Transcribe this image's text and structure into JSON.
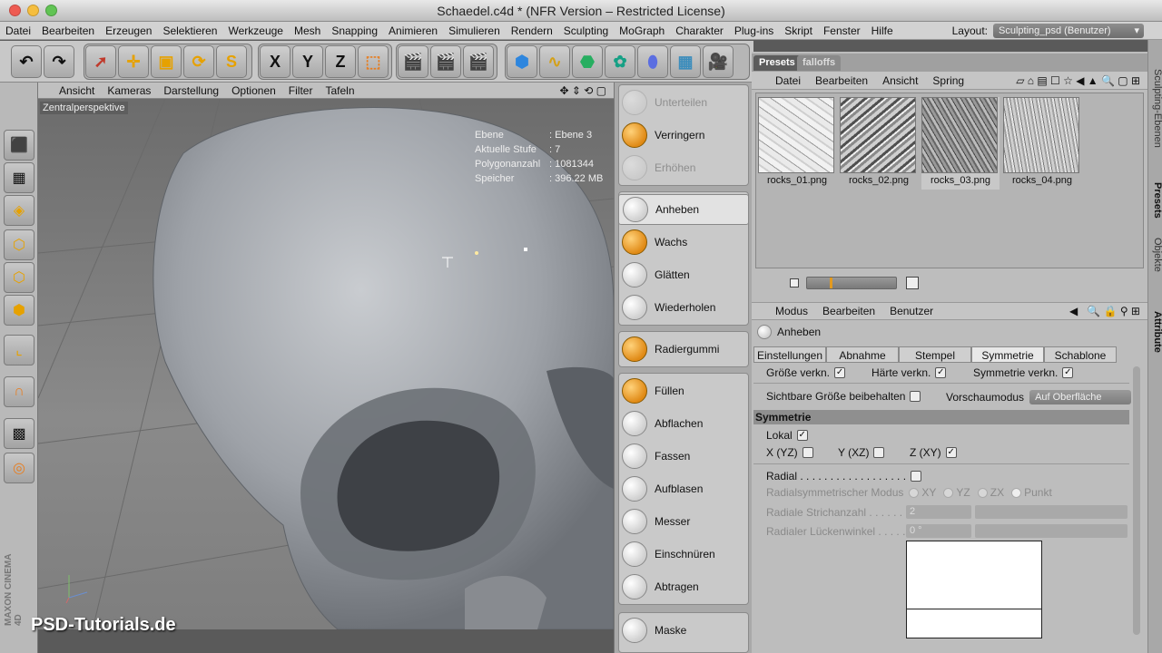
{
  "window": {
    "title": "Schaedel.c4d * (NFR Version – Restricted License)"
  },
  "menubar": {
    "items": [
      "Datei",
      "Bearbeiten",
      "Erzeugen",
      "Selektieren",
      "Werkzeuge",
      "Mesh",
      "Snapping",
      "Animieren",
      "Simulieren",
      "Rendern",
      "Sculpting",
      "MoGraph",
      "Charakter",
      "Plug-ins",
      "Skript",
      "Fenster",
      "Hilfe"
    ],
    "layout_label": "Layout:",
    "layout_value": "Sculpting_psd (Benutzer)"
  },
  "toolbar": {
    "axis_x": "X",
    "axis_y": "Y",
    "axis_z": "Z"
  },
  "viewport": {
    "menu": [
      "Ansicht",
      "Kameras",
      "Darstellung",
      "Optionen",
      "Filter",
      "Tafeln"
    ],
    "label": "Zentralperspektive",
    "hud": [
      {
        "k": "Ebene",
        "v": ": Ebene 3"
      },
      {
        "k": "Aktuelle Stufe",
        "v": ": 7"
      },
      {
        "k": "Polygonanzahl",
        "v": ": 1081344"
      },
      {
        "k": "Speicher",
        "v": ": 396.22 MB"
      }
    ],
    "watermark": "PSD-Tutorials.de",
    "brand": "MAXON CINEMA 4D"
  },
  "brushes": {
    "top": [
      "Unterteilen",
      "Verringern",
      "Erhöhen"
    ],
    "main": [
      "Anheben",
      "Wachs",
      "Glätten",
      "Wiederholen"
    ],
    "eraser": "Radiergummi",
    "tools": [
      "Füllen",
      "Abflachen",
      "Fassen",
      "Aufblasen",
      "Messer",
      "Einschnüren",
      "Abtragen"
    ],
    "mask": "Maske"
  },
  "presets": {
    "tabs": [
      "Presets",
      "falloffs"
    ],
    "menu": [
      "Datei",
      "Bearbeiten",
      "Ansicht",
      "Spring"
    ],
    "thumbs": [
      "rocks_01.png",
      "rocks_02.png",
      "rocks_03.png",
      "rocks_04.png"
    ]
  },
  "attributes": {
    "menu": [
      "Modus",
      "Bearbeiten",
      "Benutzer"
    ],
    "title": "Anheben",
    "tabs": [
      "Einstellungen",
      "Abnahme",
      "Stempel",
      "Symmetrie",
      "Schablone"
    ],
    "active_tab": "Symmetrie",
    "row1": {
      "a": "Größe verkn.",
      "b": "Härte verkn.",
      "c": "Symmetrie verkn."
    },
    "row2": {
      "a": "Sichtbare Größe beibehalten",
      "b": "Vorschaumodus",
      "b_value": "Auf Oberfläche"
    },
    "section": "Symmetrie",
    "lokal": "Lokal",
    "axes": [
      "X (YZ)",
      "Y (XZ)",
      "Z (XY)"
    ],
    "radial": "Radial . . . . . . . . . . . . . . . . . . . .",
    "radial_mode": "Radialsymmetrischer Modus",
    "radial_mode_opts": [
      "XY",
      "YZ",
      "ZX",
      "Punkt"
    ],
    "radial_count": "Radiale Strichanzahl . . . . . . .",
    "radial_count_value": "2",
    "radial_gap": "Radialer Lückenwinkel . . . . . .",
    "radial_gap_value": "0 °"
  },
  "sidetabs": [
    "Sculpting-Ebenen",
    "Presets",
    "Objekte",
    "Attribute"
  ]
}
